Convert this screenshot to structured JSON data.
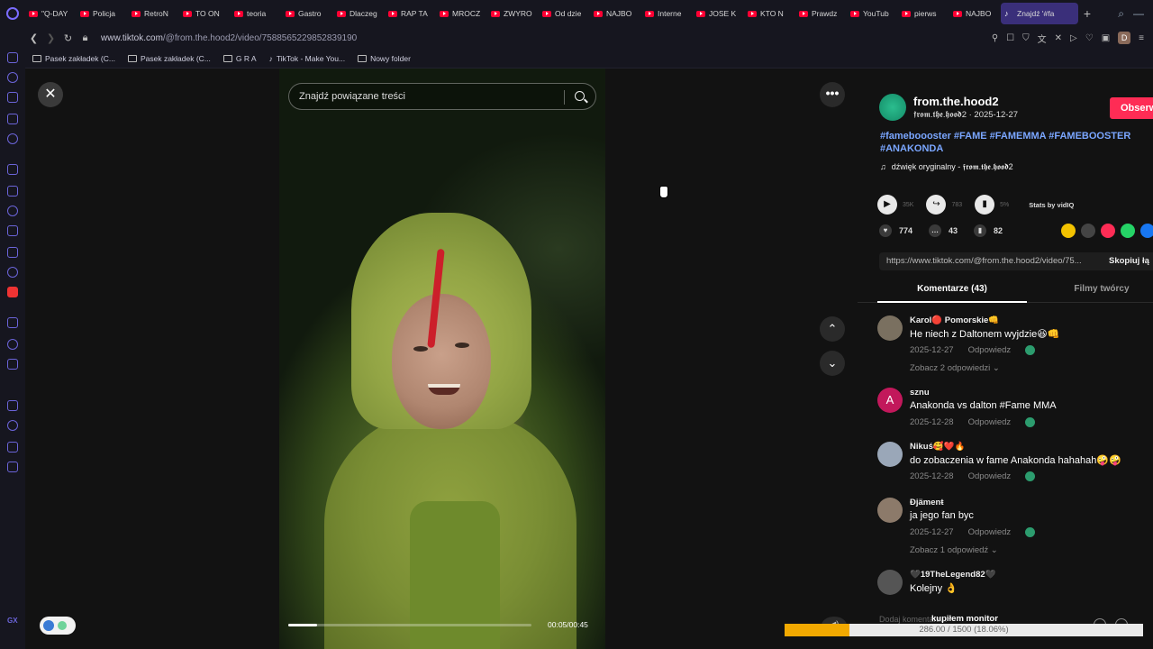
{
  "tabs": [
    {
      "label": "\"Q-DAY"
    },
    {
      "label": "Policja"
    },
    {
      "label": "RetroN"
    },
    {
      "label": "TO ON"
    },
    {
      "label": "teoria"
    },
    {
      "label": "Gastro"
    },
    {
      "label": "Dlaczeg"
    },
    {
      "label": "RAP TA"
    },
    {
      "label": "MROCZ"
    },
    {
      "label": "ZWYRO"
    },
    {
      "label": "Od dzie"
    },
    {
      "label": "NAJBO"
    },
    {
      "label": "Interne"
    },
    {
      "label": "JOSE K"
    },
    {
      "label": "KTO N"
    },
    {
      "label": "Prawdz"
    },
    {
      "label": "YouTub"
    },
    {
      "label": "pierws"
    },
    {
      "label": "NAJBO"
    }
  ],
  "active_tab": {
    "label": "Znajdź '#fa"
  },
  "browser": {
    "url_host": "www.tiktok.com",
    "url_path": "/@from.the.hood2/video/7588565229852839190",
    "avatar_letter": "D"
  },
  "bookmarks": [
    {
      "label": "Pasek zakładek (C..."
    },
    {
      "label": "Pasek zakładek (C..."
    },
    {
      "label": "G R A"
    },
    {
      "label": "TikTok - Make You..."
    },
    {
      "label": "Nowy folder"
    }
  ],
  "video": {
    "search_placeholder": "Znajdź powiązane treści",
    "time": "00:05/00:45",
    "progress": 0.12
  },
  "post": {
    "author": "from.the.hood2",
    "author_sub": "𝖋𝖗𝖔𝖒.𝖙𝖍𝖊.𝖍𝖔𝖔𝖉2 · 2025-12-27",
    "follow_label": "Obserw",
    "hashtags": "#fameboooster #FAME #FAMEMMA #FAMEBOOSTER #ANAKONDA",
    "sound": "dźwięk oryginalny - 𝖋𝖗𝖔𝖒.𝖙𝖍𝖊.𝖍𝖔𝖔𝖉2",
    "plays": "35K",
    "shares_faint": "783",
    "engagement": "5%",
    "stats_by": "Stats by vidIQ",
    "likes": "774",
    "comments": "43",
    "saves": "82",
    "link": "https://www.tiktok.com/@from.the.hood2/video/75...",
    "copy_label": "Skopiuj łą"
  },
  "panel_tabs": {
    "comments": "Komentarze (43)",
    "creator": "Filmy twórcy"
  },
  "comments": [
    {
      "user": "Karol🔴 Pomorskie👊",
      "text": "He niech z Daltonem wyjdzie😆👊",
      "date": "2025-12-27",
      "reply": "Odpowiedz",
      "replies": "Zobacz 2 odpowiedzi ⌄"
    },
    {
      "user": "sznu",
      "text": "Anakonda vs dalton #Fame MMA",
      "date": "2025-12-28",
      "reply": "Odpowiedz",
      "replies": ""
    },
    {
      "user": "Nikuś🥰❤️🔥",
      "text": "do zobaczenia w fame Anakonda hahahah🤪🤪",
      "date": "2025-12-28",
      "reply": "Odpowiedz",
      "replies": ""
    },
    {
      "user": "Ðjämenŧ",
      "text": "ja jego fan byc",
      "date": "2025-12-27",
      "reply": "Odpowiedz",
      "replies": "Zobacz 1 odpowiedź ⌄"
    },
    {
      "user": "🖤19TheLegend82🖤",
      "text": "Kolejny 👌",
      "date": "",
      "reply": "",
      "replies": ""
    }
  ],
  "comment_input_placeholder": "Dodaj komentarz...",
  "overlay": {
    "label": "kupiłem monitor",
    "progress_text": "286.00 / 1500 (18.06%)",
    "progress": 0.1806
  },
  "colors": {
    "accent": "#fe2c55",
    "hashtag": "#7aa6ff",
    "overlay_fill": "#f2a900"
  }
}
